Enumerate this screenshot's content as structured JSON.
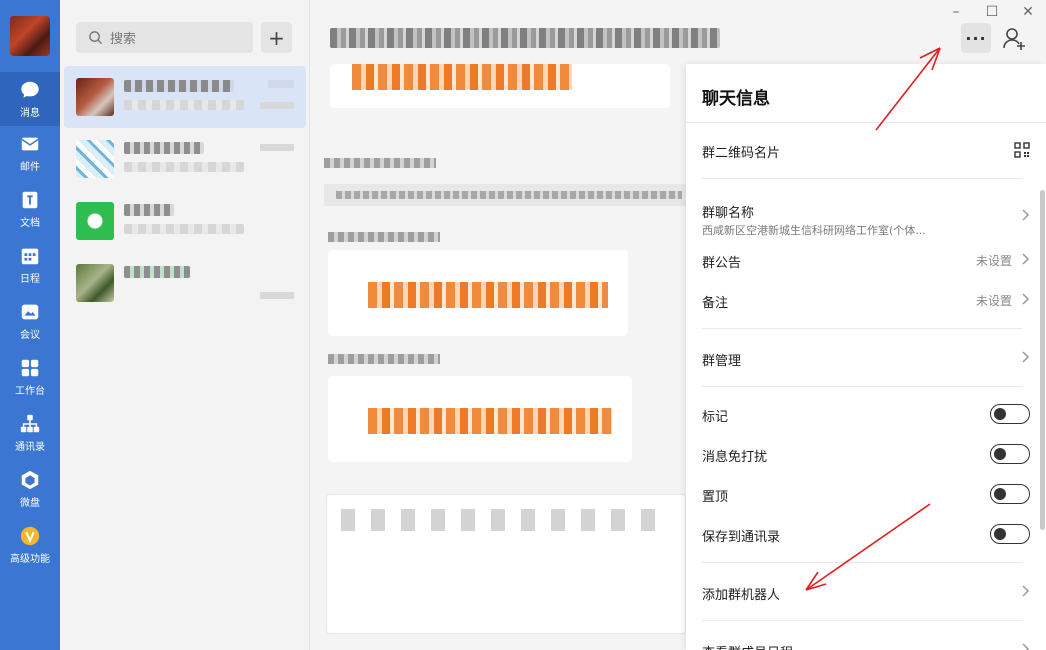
{
  "nav": {
    "items": [
      {
        "label": "消息",
        "icon": "chat-icon"
      },
      {
        "label": "邮件",
        "icon": "mail-icon"
      },
      {
        "label": "文档",
        "icon": "document-icon"
      },
      {
        "label": "日程",
        "icon": "calendar-icon"
      },
      {
        "label": "会议",
        "icon": "meeting-icon"
      },
      {
        "label": "工作台",
        "icon": "apps-icon"
      },
      {
        "label": "通讯录",
        "icon": "contacts-icon"
      },
      {
        "label": "微盘",
        "icon": "drive-icon"
      },
      {
        "label": "高级功能",
        "icon": "premium-icon"
      }
    ]
  },
  "search": {
    "placeholder": "搜索"
  },
  "info_panel": {
    "title": "聊天信息",
    "rows": {
      "qr": {
        "label": "群二维码名片"
      },
      "group_name": {
        "label": "群聊名称",
        "value": "西咸新区空港新城生信科研网络工作室(个体..."
      },
      "announcement": {
        "label": "群公告",
        "value": "未设置"
      },
      "remark": {
        "label": "备注",
        "value": "未设置"
      },
      "manage": {
        "label": "群管理"
      },
      "mark": {
        "label": "标记"
      },
      "mute": {
        "label": "消息免打扰"
      },
      "pin": {
        "label": "置顶"
      },
      "save_contacts": {
        "label": "保存到通讯录"
      },
      "add_bot": {
        "label": "添加群机器人"
      },
      "schedule": {
        "label": "查看群成员日程"
      }
    }
  },
  "colors": {
    "rail": "#3a76d2",
    "selected": "#d9e5f7",
    "annotation": "#e01e1e"
  }
}
